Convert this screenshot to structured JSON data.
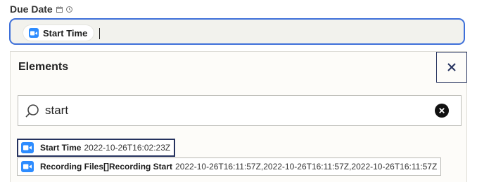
{
  "field": {
    "label": "Due Date",
    "icons": [
      "calendar-icon",
      "clock-icon"
    ]
  },
  "input": {
    "pill": {
      "icon": "zoom-video-icon",
      "label": "Start Time"
    }
  },
  "dropdown": {
    "title": "Elements",
    "close_icon": "close-icon",
    "search": {
      "value": "start",
      "icon": "search-icon",
      "clear_icon": "clear-icon"
    },
    "results": [
      {
        "icon": "zoom-video-icon",
        "name": "Start Time",
        "value": "2022-10-26T16:02:23Z"
      },
      {
        "icon": "zoom-video-icon",
        "name": "Recording Files[]Recording Start",
        "value": "2022-10-26T16:11:57Z,2022-10-26T16:11:57Z,2022-10-26T16:11:57Z"
      }
    ]
  },
  "colors": {
    "accent": "#3d6fd9",
    "zoom": "#2d8cff",
    "focus": "#25325e"
  }
}
